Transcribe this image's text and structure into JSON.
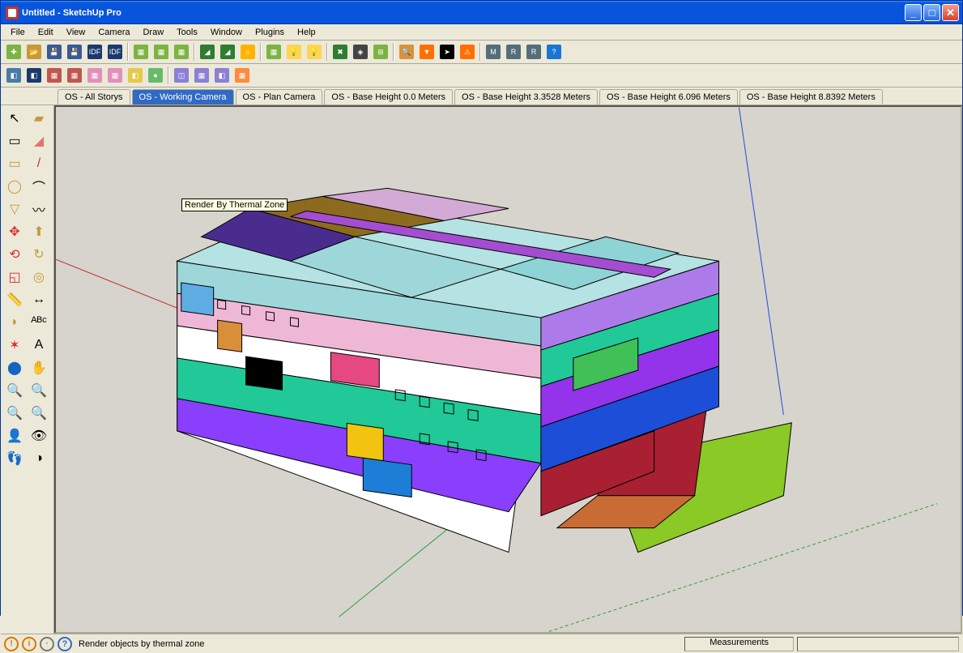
{
  "window": {
    "title": "Untitled - SketchUp Pro"
  },
  "menu": {
    "items": [
      "File",
      "Edit",
      "View",
      "Camera",
      "Draw",
      "Tools",
      "Window",
      "Plugins",
      "Help"
    ]
  },
  "tabs": [
    "OS - All Storys",
    "OS - Working Camera",
    "OS - Plan Camera",
    "OS - Base Height 0.0 Meters",
    "OS - Base Height 3.3528 Meters",
    "OS - Base Height 6.096 Meters",
    "OS - Base Height 8.8392 Meters"
  ],
  "tabs_selected": 1,
  "tooltip": "Render By Thermal Zone",
  "status": {
    "hint": "Render objects by thermal zone",
    "measure_label": "Measurements"
  },
  "toolbar_row1": [
    {
      "name": "new",
      "bg": "#7cb342",
      "glyph": "✚"
    },
    {
      "name": "open",
      "bg": "#c49a3a",
      "glyph": "📂"
    },
    {
      "name": "save",
      "bg": "#3b5998",
      "glyph": "💾"
    },
    {
      "name": "save-copy",
      "bg": "#3b5998",
      "glyph": "💾"
    },
    {
      "name": "import-idf",
      "bg": "#1a3a6e",
      "glyph": "IDF"
    },
    {
      "name": "export-idf",
      "bg": "#1a3a6e",
      "glyph": "IDF"
    },
    {
      "name": "sep"
    },
    {
      "name": "building",
      "bg": "#7cb342",
      "glyph": "▦"
    },
    {
      "name": "building-alt",
      "bg": "#7cb342",
      "glyph": "▦"
    },
    {
      "name": "add-building",
      "bg": "#7cb342",
      "glyph": "▦"
    },
    {
      "name": "sep"
    },
    {
      "name": "surface",
      "bg": "#2e7d32",
      "glyph": "◢"
    },
    {
      "name": "surface-add",
      "bg": "#2e7d32",
      "glyph": "◢"
    },
    {
      "name": "surface-sun",
      "bg": "#ffb300",
      "glyph": "☼"
    },
    {
      "name": "sep"
    },
    {
      "name": "grid",
      "bg": "#7cb342",
      "glyph": "▦"
    },
    {
      "name": "light",
      "bg": "#ffd54f",
      "glyph": "💡"
    },
    {
      "name": "light-add",
      "bg": "#ffd54f",
      "glyph": "💡"
    },
    {
      "name": "sep"
    },
    {
      "name": "tools",
      "bg": "#2e7d32",
      "glyph": "✖"
    },
    {
      "name": "layers",
      "bg": "#444",
      "glyph": "◈"
    },
    {
      "name": "grid4",
      "bg": "#7cb342",
      "glyph": "⊞"
    },
    {
      "name": "sep"
    },
    {
      "name": "search",
      "bg": "#d8923b",
      "glyph": "🔍"
    },
    {
      "name": "filter",
      "bg": "#ff6f00",
      "glyph": "▼"
    },
    {
      "name": "arrow",
      "bg": "#000",
      "glyph": "➤"
    },
    {
      "name": "warning",
      "bg": "#ff6f00",
      "glyph": "⚠"
    },
    {
      "name": "sep"
    },
    {
      "name": "cube-m",
      "bg": "#546e7a",
      "glyph": "M"
    },
    {
      "name": "cube-r",
      "bg": "#546e7a",
      "glyph": "R"
    },
    {
      "name": "cube-rv",
      "bg": "#546e7a",
      "glyph": "R"
    },
    {
      "name": "help",
      "bg": "#1976d2",
      "glyph": "?"
    }
  ],
  "toolbar_row2": [
    {
      "name": "box-blue1",
      "bg": "#4a7aa8",
      "glyph": "◧"
    },
    {
      "name": "box-blue2",
      "bg": "#1a3a6e",
      "glyph": "◧"
    },
    {
      "name": "box-red1",
      "bg": "#c0564f",
      "glyph": "▦"
    },
    {
      "name": "box-red2",
      "bg": "#c0564f",
      "glyph": "▦"
    },
    {
      "name": "box-pink1",
      "bg": "#e091b8",
      "glyph": "▦"
    },
    {
      "name": "box-pink2",
      "bg": "#e091b8",
      "glyph": "▦"
    },
    {
      "name": "box-yellow",
      "bg": "#e6c84a",
      "glyph": "◧"
    },
    {
      "name": "drop",
      "bg": "#66bb6a",
      "glyph": "●"
    },
    {
      "name": "sep"
    },
    {
      "name": "wire1",
      "bg": "#8c7fd6",
      "glyph": "◫"
    },
    {
      "name": "wire2",
      "bg": "#8c7fd6",
      "glyph": "▦"
    },
    {
      "name": "wire3",
      "bg": "#8c7fd6",
      "glyph": "◧"
    },
    {
      "name": "calendar",
      "bg": "#ff8a3d",
      "glyph": "▦"
    }
  ],
  "tooltray": [
    {
      "name": "select",
      "glyph": "↖",
      "c": "#000"
    },
    {
      "name": "paint",
      "glyph": "▰",
      "c": "#c49a3a"
    },
    {
      "name": "component",
      "glyph": "▭",
      "c": "#000"
    },
    {
      "name": "eraser",
      "glyph": "◢",
      "c": "#e57373"
    },
    {
      "name": "rectangle",
      "glyph": "▭",
      "c": "#c49a3a"
    },
    {
      "name": "line",
      "glyph": "/",
      "c": "#d32f2f"
    },
    {
      "name": "circle",
      "glyph": "◯",
      "c": "#c49a3a"
    },
    {
      "name": "arc",
      "glyph": "⌒",
      "c": "#000"
    },
    {
      "name": "polygon",
      "glyph": "▽",
      "c": "#c49a3a"
    },
    {
      "name": "freehand",
      "glyph": "〰",
      "c": "#000"
    },
    {
      "name": "move",
      "glyph": "✥",
      "c": "#d32f2f"
    },
    {
      "name": "pushpull",
      "glyph": "⬆",
      "c": "#c49a3a"
    },
    {
      "name": "rotate",
      "glyph": "⟲",
      "c": "#d32f2f"
    },
    {
      "name": "followme",
      "glyph": "↻",
      "c": "#c49a3a"
    },
    {
      "name": "scale",
      "glyph": "◱",
      "c": "#d32f2f"
    },
    {
      "name": "offset",
      "glyph": "◎",
      "c": "#c49a3a"
    },
    {
      "name": "tape",
      "glyph": "📏",
      "c": "#c49a3a"
    },
    {
      "name": "dimension",
      "glyph": "↔",
      "c": "#000"
    },
    {
      "name": "protractor",
      "glyph": "◗",
      "c": "#c49a3a"
    },
    {
      "name": "text",
      "glyph": "ᴬᴮᶜ",
      "c": "#000"
    },
    {
      "name": "axes",
      "glyph": "✶",
      "c": "#d32f2f"
    },
    {
      "name": "3dtext",
      "glyph": "A",
      "c": "#000"
    },
    {
      "name": "orbit",
      "glyph": "⬤",
      "c": "#1565c0"
    },
    {
      "name": "pan",
      "glyph": "✋",
      "c": "#1565c0"
    },
    {
      "name": "zoom",
      "glyph": "🔍",
      "c": "#1565c0"
    },
    {
      "name": "zoom-window",
      "glyph": "🔍",
      "c": "#1565c0"
    },
    {
      "name": "zoom-extents",
      "glyph": "🔍",
      "c": "#1565c0"
    },
    {
      "name": "previous",
      "glyph": "🔍",
      "c": "#1565c0"
    },
    {
      "name": "position",
      "glyph": "👤",
      "c": "#000"
    },
    {
      "name": "look",
      "glyph": "👁",
      "c": "#000"
    },
    {
      "name": "walk",
      "glyph": "👣",
      "c": "#000"
    },
    {
      "name": "section",
      "glyph": "◑",
      "c": "#000"
    }
  ]
}
